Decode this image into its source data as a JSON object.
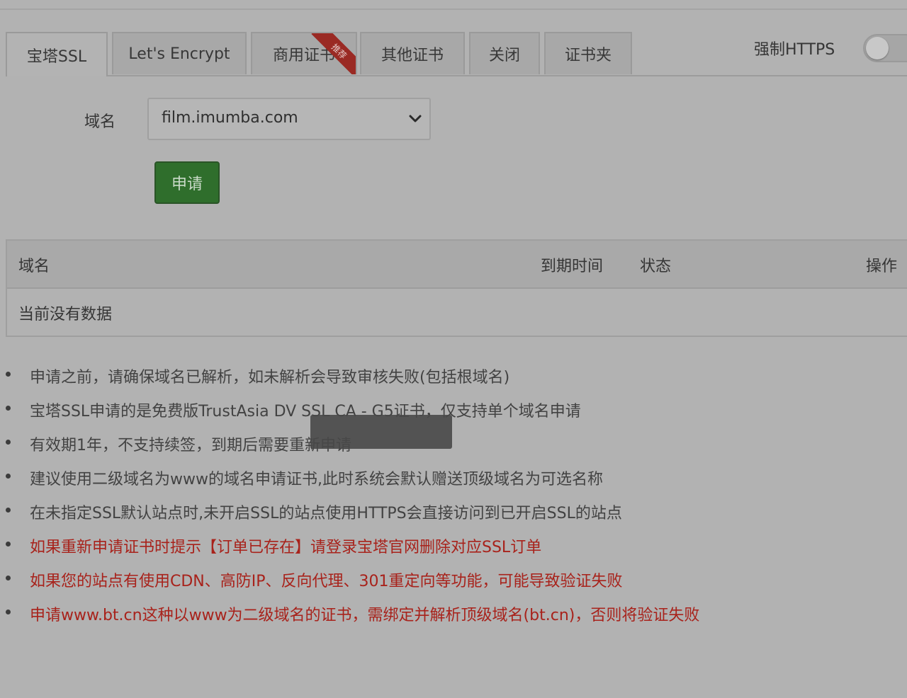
{
  "tabs": [
    {
      "label": "宝塔SSL",
      "active": true
    },
    {
      "label": "Let's Encrypt",
      "active": false
    },
    {
      "label": "商用证书",
      "active": false,
      "ribbon": "推荐"
    },
    {
      "label": "其他证书",
      "active": false
    },
    {
      "label": "关闭",
      "active": false
    },
    {
      "label": "证书夹",
      "active": false
    }
  ],
  "force_https": {
    "label": "强制HTTPS",
    "enabled": false
  },
  "form": {
    "domain_label": "域名",
    "domain_value": "film.imumba.com",
    "apply_label": "申请"
  },
  "table": {
    "headers": {
      "domain": "域名",
      "expire": "到期时间",
      "status": "状态",
      "action": "操作"
    },
    "empty": "当前没有数据"
  },
  "notes": [
    {
      "text": "申请之前，请确保域名已解析，如未解析会导致审核失败(包括根域名)",
      "warn": false
    },
    {
      "text": "宝塔SSL申请的是免费版TrustAsia DV SSL CA - G5证书，仅支持单个域名申请",
      "warn": false
    },
    {
      "text": "有效期1年，不支持续签，到期后需要重新申请",
      "warn": false
    },
    {
      "text": "建议使用二级域名为www的域名申请证书,此时系统会默认赠送顶级域名为可选名称",
      "warn": false
    },
    {
      "text": "在未指定SSL默认站点时,未开启SSL的站点使用HTTPS会直接访问到已开启SSL的站点",
      "warn": false
    },
    {
      "text": "如果重新申请证书时提示【订单已存在】请登录宝塔官网删除对应SSL订单",
      "warn": true
    },
    {
      "text": "如果您的站点有使用CDN、高防IP、反向代理、301重定向等功能，可能导致验证失败",
      "warn": true
    },
    {
      "text": "申请www.bt.cn这种以www为二级域名的证书，需绑定并解析顶级域名(bt.cn)，否则将验证失败",
      "warn": true
    }
  ],
  "colors": {
    "overlay_bg": "#b2b2b2",
    "apply_button": "#2f6e2c",
    "warn_text": "#a8221b",
    "ribbon": "#9a2a24"
  }
}
